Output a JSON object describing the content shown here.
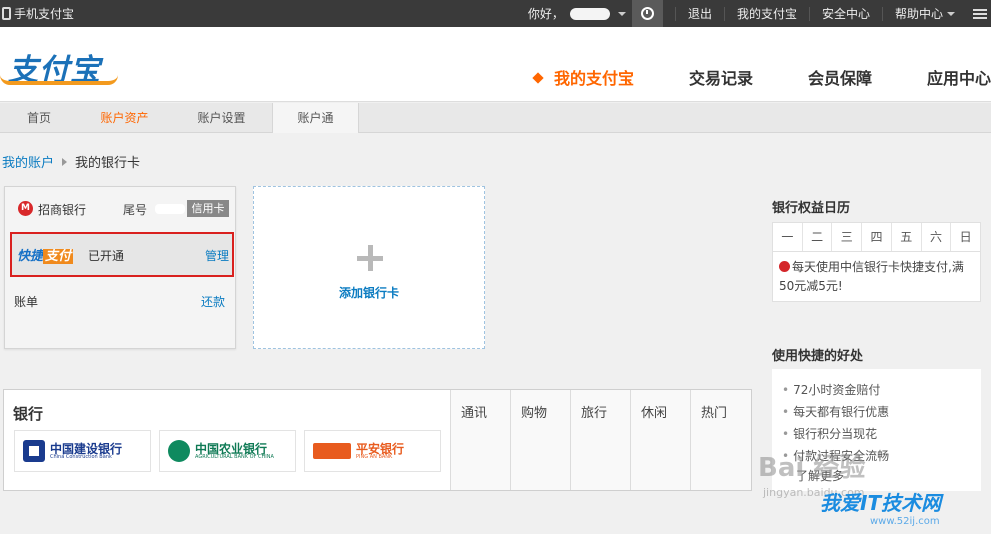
{
  "topbar": {
    "mobile_label": "手机支付宝",
    "greeting": "你好，",
    "links": [
      "退出",
      "我的支付宝",
      "安全中心",
      "帮助中心"
    ]
  },
  "brand": {
    "logo_text": "支付宝",
    "accent": "#ff6600",
    "link_color": "#0a7bc1"
  },
  "mainnav": [
    "我的支付宝",
    "交易记录",
    "会员保障",
    "应用中心"
  ],
  "subnav": [
    "首页",
    "账户资产",
    "账户设置",
    "账户通"
  ],
  "breadcrumb": {
    "root": "我的账户",
    "current": "我的银行卡"
  },
  "card": {
    "bank": "招商银行",
    "tail_label": "尾号",
    "type_tag": "信用卡",
    "quickpay_logo_a": "快捷",
    "quickpay_logo_b": "支付",
    "quickpay_status": "已开通",
    "manage": "管理",
    "bill": "账单",
    "repay": "还款"
  },
  "add_card": {
    "label": "添加银行卡"
  },
  "bank_list": {
    "title": "银行",
    "banks": [
      {
        "zh": "中国建设银行",
        "en": "China Construction Bank"
      },
      {
        "zh": "中国农业银行",
        "en": "AGRICULTURAL BANK OF CHINA"
      },
      {
        "zh": "平安银行",
        "en": "PING AN BANK"
      }
    ],
    "categories": [
      "通讯",
      "购物",
      "旅行",
      "休闲",
      "热门"
    ]
  },
  "calendar": {
    "title": "银行权益日历",
    "days": [
      "一",
      "二",
      "三",
      "四",
      "五",
      "六",
      "日"
    ],
    "promo": "每天使用中信银行卡快捷支付,满50元减5元!"
  },
  "benefits": {
    "title": "使用快捷的好处",
    "items": [
      "72小时资金赔付",
      "每天都有银行优惠",
      "银行积分当现花",
      "付款过程安全流畅"
    ],
    "more": "了解更多"
  },
  "watermarks": {
    "baidu": "Bai 经验",
    "baidu_url": "jingyan.baidu.com",
    "site": "我爱IT技术网",
    "site_url": "www.52ij.com"
  }
}
